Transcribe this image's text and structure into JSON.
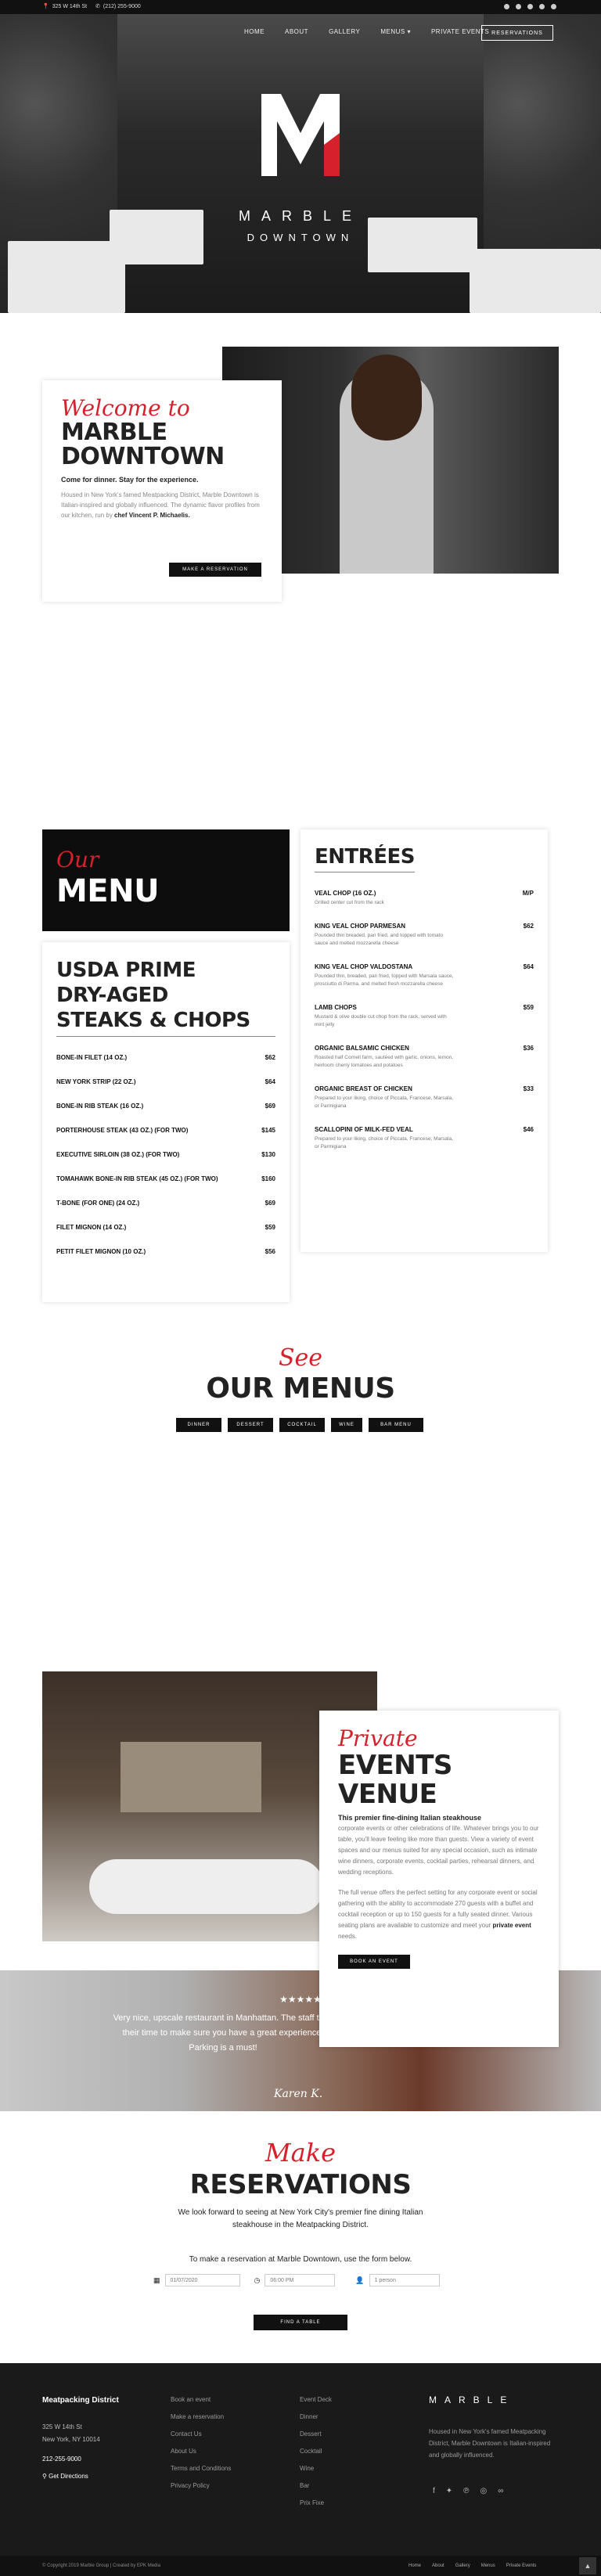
{
  "topbar": {
    "address": "325 W 14th St",
    "phone": "(212) 255-9000"
  },
  "nav": {
    "items": [
      "HOME",
      "ABOUT",
      "GALLERY",
      "MENUS ▾",
      "PRIVATE EVENTS"
    ],
    "reserve": "RESERVATIONS"
  },
  "hero": {
    "brand": "MARBLE",
    "sub": "DOWNTOWN"
  },
  "welcome": {
    "script": "Welcome to",
    "title1": "MARBLE",
    "title2": "DOWNTOWN",
    "tagline": "Come for dinner. Stay for the experience.",
    "body": "Housed in New York's famed Meatpacking District, Marble Downtown is Italian-inspired and globally influenced. The dynamic flavor profiles from our kitchen, run by ",
    "chef": "chef Vincent P. Michaelis.",
    "button": "MAKE A RESERVATION"
  },
  "menu": {
    "script": "Our",
    "title": "MENU",
    "steaks_title": "USDA PRIME DRY-AGED STEAKS & CHOPS",
    "steaks": [
      {
        "n": "BONE-IN FILET (14 OZ.)",
        "p": "$62"
      },
      {
        "n": "NEW YORK STRIP (22 OZ.)",
        "p": "$64"
      },
      {
        "n": "BONE-IN RIB STEAK (16 OZ.)",
        "p": "$69"
      },
      {
        "n": "PORTERHOUSE STEAK (43 OZ.) (FOR TWO)",
        "p": "$145"
      },
      {
        "n": "EXECUTIVE SIRLOIN (38 OZ.) (FOR TWO)",
        "p": "$130"
      },
      {
        "n": "TOMAHAWK BONE-IN RIB STEAK (45 OZ.) (FOR TWO)",
        "p": "$160"
      },
      {
        "n": "T-BONE (FOR ONE) (24 OZ.)",
        "p": "$69"
      },
      {
        "n": "FILET MIGNON (14 OZ.)",
        "p": "$59"
      },
      {
        "n": "PETIT FILET MIGNON (10 OZ.)",
        "p": "$56"
      }
    ],
    "entrees_title": "ENTRÉES",
    "entrees": [
      {
        "n": "VEAL CHOP (16 OZ.)",
        "p": "M/P",
        "d": "Grilled center cut from the rack"
      },
      {
        "n": "KING VEAL CHOP PARMESAN",
        "p": "$62",
        "d": "Pounded thin breaded, pan fried, and topped with tomato sauce and melted mozzarella cheese"
      },
      {
        "n": "KING VEAL CHOP VALDOSTANA",
        "p": "$64",
        "d": "Pounded thin, breaded, pan fried, topped with Marsala sauce, prosciutto di Parma, and melted fresh mozzarella cheese"
      },
      {
        "n": "LAMB CHOPS",
        "p": "$59",
        "d": "Mustard & olive double cut chop from the rack, served with mint jelly"
      },
      {
        "n": "ORGANIC BALSAMIC CHICKEN",
        "p": "$36",
        "d": "Roasted half Cornell farm, sautéed with garlic, onions, lemon, heirloom cherry tomatoes and potatoes"
      },
      {
        "n": "ORGANIC BREAST OF CHICKEN",
        "p": "$33",
        "d": "Prepared to your liking, choice of Piccata, Francese, Marsala, or Parmigiana"
      },
      {
        "n": "SCALLOPINI OF MILK-FED VEAL",
        "p": "$46",
        "d": "Prepared to your liking, choice of Piccata, Francese, Marsala, or Parmigiana"
      }
    ]
  },
  "see": {
    "script": "See",
    "title": "OUR MENUS",
    "tabs": [
      "DINNER",
      "DESSERT",
      "COCKTAIL",
      "WINE",
      "BAR MENU"
    ]
  },
  "events": {
    "script": "Private",
    "title1": "EVENTS",
    "title2": "VENUE",
    "lead": "This premier fine-dining Italian steakhouse",
    "p1": "corporate events or other celebrations of life. Whatever brings you to our table, you'll leave feeling like more than guests. View a variety of event spaces and our menus suited for any special occasion, such as intimate wine dinners, corporate events, cocktail parties, rehearsal dinners, and wedding receptions.",
    "p2": "The full venue offers the perfect setting for any corporate event or social gathering with the ability to accommodate 270 guests with a buffet and cocktail reception or up to 150 guests for a fully seated dinner. Various seating plans are available to customize and meet your ",
    "p2b": "private event",
    "p2c": " needs.",
    "button": "BOOK AN EVENT"
  },
  "testimonial": {
    "stars": "★★★★★",
    "text": "Very nice, upscale restaurant in Manhattan. The staff take their time to make sure you have a great experience. Parking is a must!",
    "author": "Karen K."
  },
  "reserve": {
    "script": "Make",
    "title": "RESERVATIONS",
    "lead": "We look forward to seeing at New York City's premier fine dining Italian steakhouse in the Meatpacking District.",
    "sub": "To make a reservation at Marble Downtown, use the form below.",
    "date": "01/07/2020",
    "time": "06:00 PM",
    "people": "1 person",
    "button": "FIND A TABLE"
  },
  "footer": {
    "name": "Meatpacking District",
    "addr1": "325 W 14th St",
    "addr2": "New York, NY 10014",
    "phone": "212-255-9000",
    "directions": "Get Directions",
    "col2": [
      "Book an event",
      "Make a reservation",
      "Contact Us",
      "About Us",
      "Terms and Conditions",
      "Privacy Policy"
    ],
    "col3": [
      "Event Deck",
      "Dinner",
      "Dessert",
      "Cocktail",
      "Wine",
      "Bar",
      "Prix Fixe"
    ],
    "brand": "MARBLE",
    "blurb": "Housed in New York's famed Meatpacking District, Marble Downtown is Italian-inspired and globally influenced.",
    "copyright": "© Copyright 2019 Marble Group | Created by EPK Media",
    "bottom": [
      "Home",
      "About",
      "Gallery",
      "Menus",
      "Private Events"
    ]
  },
  "colors": {
    "accent": "#d6202b",
    "dark": "#111111"
  }
}
